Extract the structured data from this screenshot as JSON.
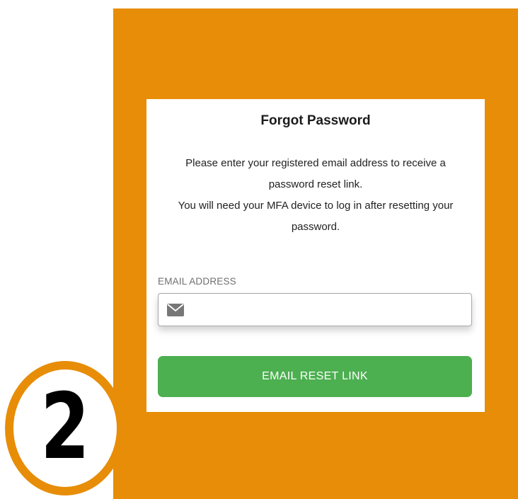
{
  "form": {
    "title": "Forgot Password",
    "instructions": [
      "Please enter your registered email address to receive a",
      "password reset link.",
      "You will need your MFA device to log in after resetting your",
      "password."
    ],
    "email_label": "EMAIL ADDRESS",
    "email_value": "",
    "email_icon": "mail-icon",
    "submit_label": "EMAIL RESET LINK"
  },
  "step_badge": {
    "number": "2"
  },
  "colors": {
    "frame": "#e78d08",
    "button": "#4caf50",
    "button_text": "#ffffff"
  }
}
